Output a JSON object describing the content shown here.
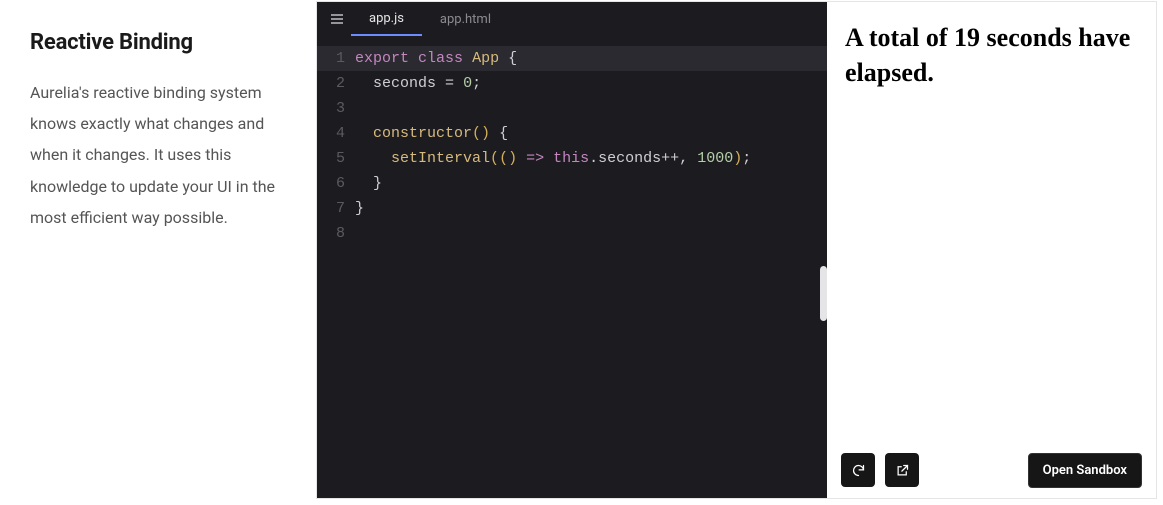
{
  "description": {
    "title": "Reactive Binding",
    "body": "Aurelia's reactive binding system knows exactly what changes and when it changes. It uses this knowledge to update your UI in the most efficient way possible."
  },
  "editor": {
    "tabs": [
      {
        "label": "app.js",
        "active": true
      },
      {
        "label": "app.html",
        "active": false
      }
    ],
    "lines": [
      {
        "n": 1,
        "hl": true,
        "tokens": [
          [
            "kw",
            "export"
          ],
          [
            "sp",
            " "
          ],
          [
            "kw",
            "class"
          ],
          [
            "sp",
            " "
          ],
          [
            "type",
            "App"
          ],
          [
            "sp",
            " "
          ],
          [
            "op",
            "{"
          ]
        ]
      },
      {
        "n": 2,
        "hl": false,
        "tokens": [
          [
            "sp",
            "  "
          ],
          [
            "ident",
            "seconds"
          ],
          [
            "sp",
            " "
          ],
          [
            "op",
            "="
          ],
          [
            "sp",
            " "
          ],
          [
            "num",
            "0"
          ],
          [
            "op",
            ";"
          ]
        ]
      },
      {
        "n": 3,
        "hl": false,
        "tokens": []
      },
      {
        "n": 4,
        "hl": false,
        "tokens": [
          [
            "sp",
            "  "
          ],
          [
            "fn",
            "constructor"
          ],
          [
            "par",
            "()"
          ],
          [
            "sp",
            " "
          ],
          [
            "op",
            "{"
          ]
        ]
      },
      {
        "n": 5,
        "hl": false,
        "tokens": [
          [
            "sp",
            "    "
          ],
          [
            "fn",
            "setInterval"
          ],
          [
            "par",
            "("
          ],
          [
            "par",
            "()"
          ],
          [
            "sp",
            " "
          ],
          [
            "arrow",
            "=>"
          ],
          [
            "sp",
            " "
          ],
          [
            "this",
            "this"
          ],
          [
            "op",
            "."
          ],
          [
            "ident",
            "seconds"
          ],
          [
            "op",
            "++"
          ],
          [
            "op",
            ","
          ],
          [
            "sp",
            " "
          ],
          [
            "num",
            "1000"
          ],
          [
            "par",
            ")"
          ],
          [
            "op",
            ";"
          ]
        ]
      },
      {
        "n": 6,
        "hl": false,
        "tokens": [
          [
            "sp",
            "  "
          ],
          [
            "op",
            "}"
          ]
        ]
      },
      {
        "n": 7,
        "hl": false,
        "tokens": [
          [
            "op",
            "}"
          ]
        ]
      },
      {
        "n": 8,
        "hl": false,
        "tokens": []
      }
    ]
  },
  "preview": {
    "heading": "A total of 19 seconds have elapsed.",
    "open_label": "Open Sandbox"
  }
}
